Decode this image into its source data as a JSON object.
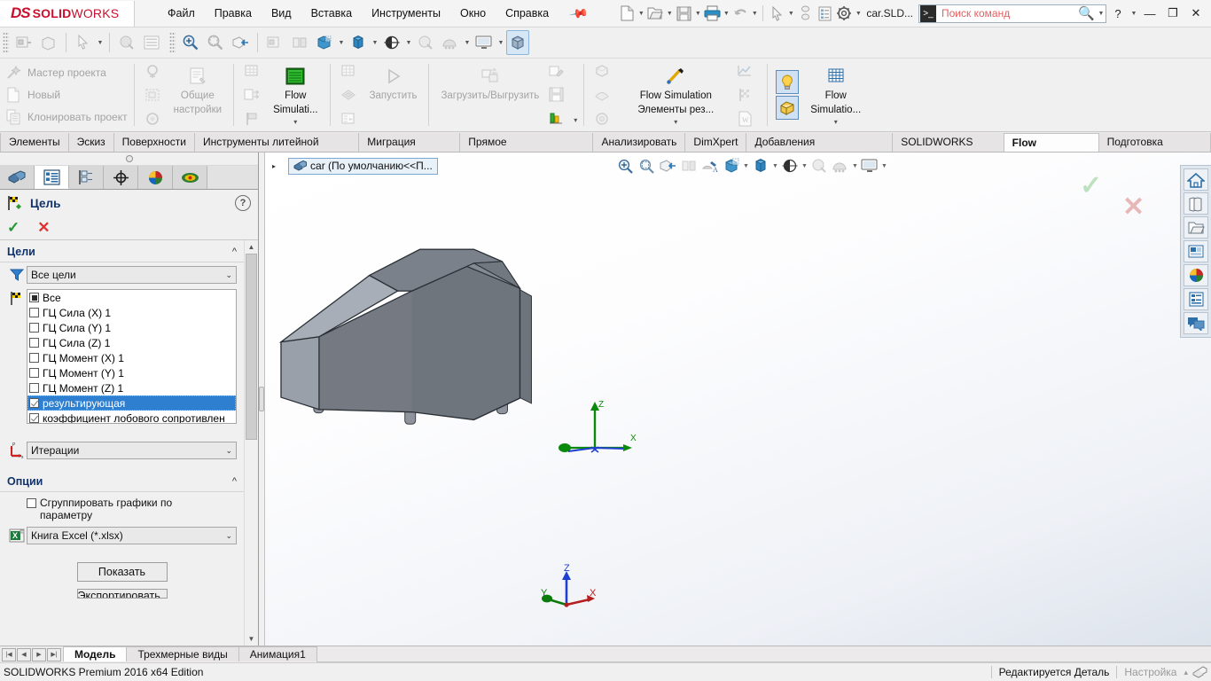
{
  "titlebar": {
    "logo": {
      "ds": "DS",
      "solid": "SOLID",
      "works": "WORKS"
    },
    "menu": [
      "Файл",
      "Правка",
      "Вид",
      "Вставка",
      "Инструменты",
      "Окно",
      "Справка"
    ],
    "pin_icon": "pin-icon",
    "doc_name": "car.SLD...",
    "search_placeholder": "Поиск команд",
    "quick_icons": [
      "new-document-icon",
      "open-folder-icon",
      "save-icon",
      "print-icon",
      "undo-icon",
      "select-icon",
      "rebuild-icon",
      "list-icon",
      "options-gear-icon"
    ],
    "help_label": "?",
    "minimize_label": "—",
    "restore_label": "❐",
    "close_label": "✕"
  },
  "quicktoolbar": {
    "group1": [
      "insert-component-icon",
      "edit-component-icon",
      "select-arrow-icon",
      "shaded-sketch-icon",
      "list-items-icon"
    ],
    "group2": [
      "zoom-area-icon",
      "zoom-fit-icon",
      "section-view-icon",
      "insert-part-icon",
      "display-pattern-icon",
      "appearance-cube-icon",
      "view-orientation-icon",
      "display-style-icon",
      "hide-show-icon",
      "apply-scene-icon",
      "view-settings-icon",
      "isometric-cube-icon"
    ]
  },
  "ribbon": {
    "groups": [
      {
        "items": [
          {
            "label": "Мастер проекта",
            "icon": "wizard-wand-icon",
            "enabled": false
          },
          {
            "label": "Новый",
            "icon": "new-page-icon",
            "enabled": false
          },
          {
            "label": "Клонировать проект",
            "icon": "clone-project-icon",
            "enabled": false
          }
        ]
      },
      {
        "icons_left": [
          "insert-goal-icon",
          "computational-domain-icon",
          "check-geometry-icon"
        ],
        "big": {
          "label": "Общие\nнастройки",
          "line1": "Общие",
          "line2": "настройки",
          "icon": "general-settings-icon",
          "enabled": false
        }
      },
      {
        "icons_left": [
          "initial-mesh-icon",
          "local-mesh-icon",
          "mesh-flag-icon"
        ],
        "big": {
          "line1": "Flow",
          "line2": "Simulati...",
          "icon": "flow-simulation-icon",
          "enabled": true,
          "caret": "▾"
        }
      },
      {
        "icons_left": [
          "mesh-grid-icon",
          "solve-mesh-icon",
          "batch-results-icon"
        ],
        "big": {
          "label": "Запустить",
          "icon": "run-play-icon",
          "enabled": false
        }
      },
      {
        "big": {
          "label": "Загрузить/Выгрузить",
          "icon": "load-unload-icon",
          "enabled": false
        }
      },
      {
        "icons_right": [
          "edit-results-icon",
          "save-results-icon",
          "bar-chart-icon"
        ],
        "caret": "▾"
      },
      {
        "icons_left": [
          "cut-plot-icon",
          "surface-plot-icon",
          "flow-trajectory-icon"
        ],
        "big": {
          "line1": "Flow Simulation",
          "line2": "Элементы рез...",
          "icon": "results-pen-icon",
          "enabled": true,
          "caret": "▾"
        }
      },
      {
        "icons_right2": [
          "xy-plot-icon",
          "goal-plot-icon",
          "report-doc-icon"
        ]
      },
      {
        "toggles": [
          {
            "icon": "lightbulb-icon",
            "active": true
          },
          {
            "icon": "display-mesh-icon",
            "active": true
          }
        ],
        "big": {
          "line1": "Flow",
          "line2": "Simulatio...",
          "icon": "flow-grid-icon",
          "enabled": true,
          "caret": "▾"
        }
      }
    ]
  },
  "command_tabs": {
    "items": [
      "Элементы",
      "Эскиз",
      "Поверхности",
      "Инструменты литейной формы",
      "Миграция данных",
      "Прямое редактирование",
      "Анализировать",
      "DimXpert",
      "Добавления SOLIDWORKS",
      "SOLIDWORKS MBD",
      "Flow Simulation",
      "Подготовка анализа"
    ],
    "active": "Flow Simulation"
  },
  "left_panel": {
    "tabs": [
      {
        "name": "feature-manager-tab",
        "icon": "feature-tree-icon",
        "active": false
      },
      {
        "name": "property-manager-tab",
        "icon": "property-list-icon",
        "active": true
      },
      {
        "name": "configuration-manager-tab",
        "icon": "configuration-icon",
        "active": false
      },
      {
        "name": "dimxpert-manager-tab",
        "icon": "dimxpert-target-icon",
        "active": false
      },
      {
        "name": "display-manager-tab",
        "icon": "display-ball-icon",
        "active": false
      },
      {
        "name": "flow-simulation-tab",
        "icon": "flow-sim-analysis-icon",
        "active": false
      }
    ],
    "title": "Цель",
    "title_icon": "goal-flag-icon",
    "help_label": "?",
    "accept_label": "✓",
    "cancel_label": "✕",
    "goals_section": {
      "header": "Цели",
      "chevron": "^",
      "filter_icon": "filter-funnel-icon",
      "filter_value": "Все цели",
      "list_icon": "goal-flag-icon",
      "items": [
        {
          "label": "Все",
          "state": "partial"
        },
        {
          "label": "ГЦ Сила (X) 1",
          "state": "unchecked"
        },
        {
          "label": "ГЦ Сила (Y) 1",
          "state": "unchecked"
        },
        {
          "label": "ГЦ Сила (Z) 1",
          "state": "unchecked"
        },
        {
          "label": "ГЦ Момент (X) 1",
          "state": "unchecked"
        },
        {
          "label": "ГЦ Момент (Y) 1",
          "state": "unchecked"
        },
        {
          "label": "ГЦ Момент (Z) 1",
          "state": "unchecked"
        },
        {
          "label": "результирующая",
          "state": "checked",
          "selected": true
        },
        {
          "label": "коэффициент лобового сопротивлен",
          "state": "checked"
        }
      ],
      "abscissa_icon": "axis-xy-icon",
      "abscissa_value": "Итерации"
    },
    "options_section": {
      "header": "Опции",
      "chevron": "^",
      "group_checkbox_label": "Сгруппировать графики по параметру",
      "group_checkbox_checked": false,
      "export_icon": "excel-icon",
      "export_value": "Книга Excel (*.xlsx)",
      "show_button": "Показать",
      "export_button": "Экспортировать в"
    }
  },
  "viewport": {
    "tree_chip": {
      "expand_arrow": "▸",
      "icon": "part-document-icon",
      "label": "car  (По умолчанию<<П..."
    },
    "toolbar_icons": [
      "zoom-pan-icon",
      "zoom-area-icon",
      "section-view-icon",
      "hidden-edges-icon",
      "appearance-icon",
      "view-orientation-icon",
      "display-style-icon",
      "hide-show-icon",
      "apply-scene-icon",
      "view-settings-icon",
      "screen-icon"
    ],
    "confirm_check": "✓",
    "confirm_x": "✕",
    "triad": {
      "x": "X",
      "y": "Y",
      "z": "Z"
    },
    "model_origin": {
      "x": "X",
      "y": "Y",
      "z": "Z"
    },
    "right_toolbar": [
      {
        "name": "view-home-icon",
        "selected": false
      },
      {
        "name": "view-library-icon",
        "selected": false
      },
      {
        "name": "view-folder-icon",
        "selected": false
      },
      {
        "name": "view-layout-icon",
        "selected": false
      },
      {
        "name": "appearances-ball-icon",
        "selected": false
      },
      {
        "name": "custom-properties-icon",
        "selected": false
      },
      {
        "name": "comments-icon",
        "selected": false
      }
    ]
  },
  "bottom": {
    "nav_buttons": [
      "first-nav-icon",
      "prev-nav-icon",
      "next-nav-icon",
      "last-nav-icon"
    ],
    "doc_tabs": [
      "Модель",
      "Трехмерные виды",
      "Анимация1"
    ],
    "active_doc_tab": "Модель"
  },
  "statusbar": {
    "left": "SOLIDWORKS Premium 2016 x64 Edition",
    "edit_state": "Редактируется Деталь",
    "config": "Настройка",
    "config_caret": "▴",
    "right_icon": "sketch-status-icon"
  }
}
